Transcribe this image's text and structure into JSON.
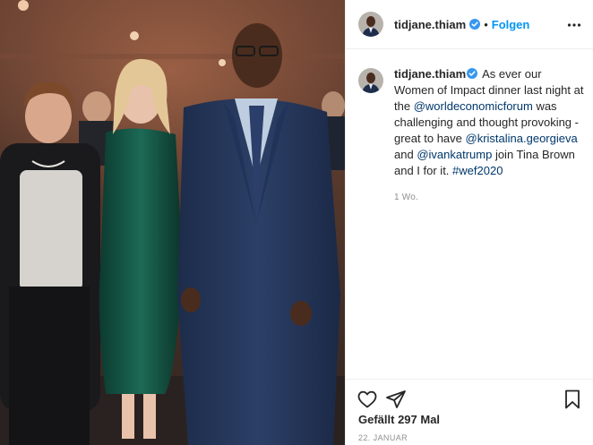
{
  "post": {
    "username": "tidjane.thiam",
    "follow_label": "Folgen",
    "separator": "•",
    "caption": {
      "username": "tidjane.thiam",
      "segments": [
        {
          "type": "text",
          "text": " As ever our Women of Impact dinner last night at the "
        },
        {
          "type": "link",
          "text": "@worldeconomicforum"
        },
        {
          "type": "text",
          "text": " was challenging and thought provoking - great to have "
        },
        {
          "type": "link",
          "text": "@kristalina.georgieva"
        },
        {
          "type": "text",
          "text": " and "
        },
        {
          "type": "link",
          "text": "@ivankatrump"
        },
        {
          "type": "text",
          "text": " join Tina Brown and I for it. "
        },
        {
          "type": "link",
          "text": "#wef2020"
        }
      ],
      "relative_time": "1 Wo."
    },
    "likes_text": "Gefällt 297 Mal",
    "date_text": "22. JANUAR",
    "icons": {
      "verified": "verified-badge-icon",
      "more": "more-options-icon",
      "like": "heart-icon",
      "share": "paper-plane-icon",
      "save": "bookmark-icon"
    },
    "colors": {
      "accent": "#0095f6",
      "link": "#00376b",
      "muted": "#8e8e8e",
      "text": "#262626",
      "border": "#efefef"
    }
  }
}
